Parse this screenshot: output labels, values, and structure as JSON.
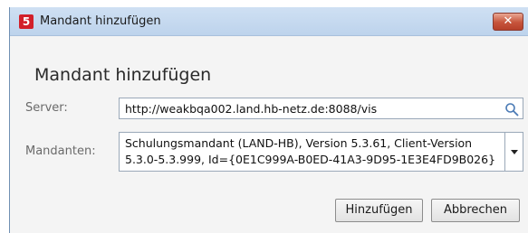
{
  "window": {
    "title": "Mandant hinzufügen",
    "app_icon_letter": "5",
    "close_glyph": "✕"
  },
  "dialog": {
    "heading": "Mandant hinzufügen",
    "server_label": "Server:",
    "server_value": "http://weakbqa002.land.hb-netz.de:8088/vis",
    "mandanten_label": "Mandanten:",
    "mandant_line1": "Schulungsmandant (LAND-HB), Version 5.3.61, Client-Version",
    "mandant_line2": "5.3.0-5.3.999, Id={0E1C999A-B0ED-41A3-9D95-1E3E4FD9B026}",
    "add_button": "Hinzufügen",
    "cancel_button": "Abbrechen"
  },
  "icons": {
    "search": "search-icon",
    "dropdown": "chevron-down-icon",
    "close": "close-icon",
    "app": "app-logo-icon"
  },
  "colors": {
    "titlebar": "#c4d8ef",
    "close_button": "#c6543b",
    "app_icon": "#d2202a",
    "search_icon": "#4a7ab5"
  }
}
